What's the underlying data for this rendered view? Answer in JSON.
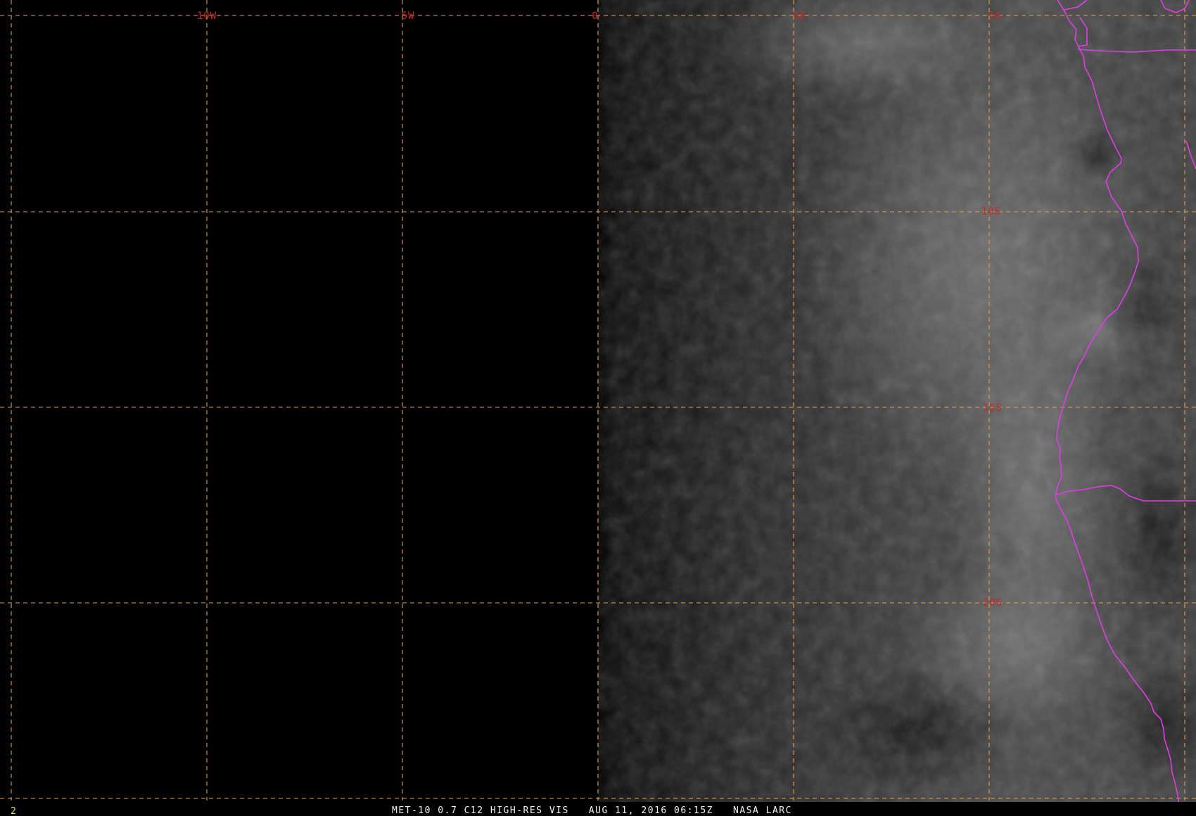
{
  "image": {
    "frame_number": "2",
    "caption": "MET-10 0.7 C12 HIGH-RES VIS   AUG 11, 2016 06:15Z   NASA LARC"
  },
  "grid": {
    "longitude_labels": [
      "10W",
      "5W",
      "0",
      "5E",
      "5S"
    ],
    "latitude_labels": [
      "10S",
      "15S",
      "20S"
    ]
  },
  "colors": {
    "grid": "#e0a050",
    "grid_label": "#cc2a1f",
    "border": "#e23ce8",
    "caption": "#f2f2f2",
    "frame_number": "#e6e030"
  }
}
